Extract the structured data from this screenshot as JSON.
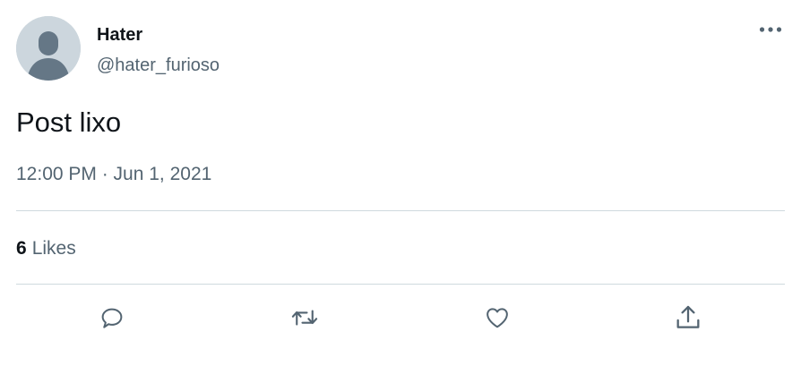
{
  "author": {
    "display_name": "Hater",
    "handle": "@hater_furioso"
  },
  "tweet": {
    "text": "Post lixo",
    "timestamp": "12:00 PM · Jun 1, 2021"
  },
  "stats": {
    "likes_count": "6",
    "likes_label": "Likes"
  },
  "actions": [
    {
      "name": "reply",
      "icon": "comment-icon"
    },
    {
      "name": "retweet",
      "icon": "retweet-icon"
    },
    {
      "name": "like",
      "icon": "heart-icon"
    },
    {
      "name": "share",
      "icon": "share-icon"
    }
  ],
  "colors": {
    "primary_text": "#0f1419",
    "secondary_text": "#536471",
    "divider": "#cfd9de",
    "avatar_bg": "#ccd6dd",
    "avatar_figure": "#657786"
  }
}
